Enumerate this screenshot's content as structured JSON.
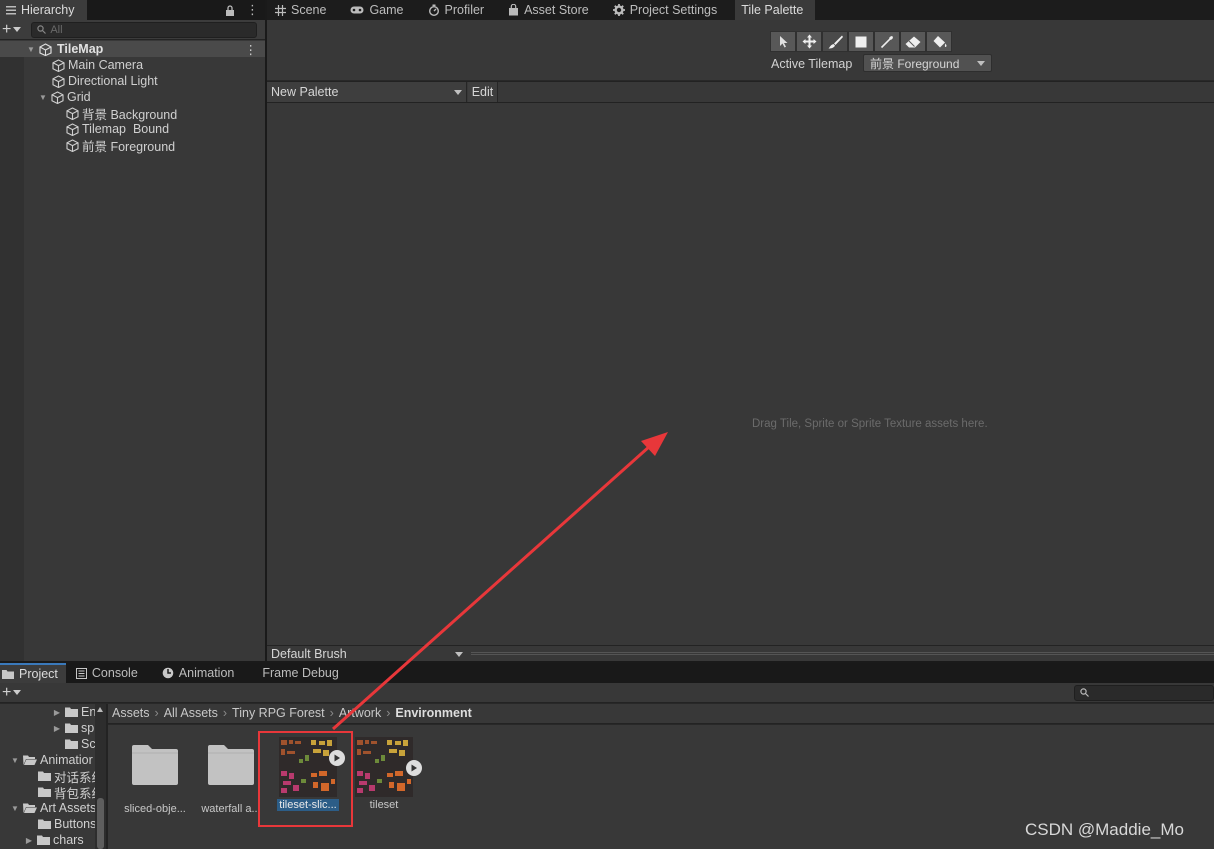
{
  "hierarchy": {
    "tab_label": "Hierarchy",
    "search_placeholder": "All",
    "scene_name": "TileMap",
    "items": [
      {
        "label": "Main Camera"
      },
      {
        "label": "Directional Light"
      },
      {
        "label": "Grid"
      },
      {
        "label": "背景 Background"
      },
      {
        "label": "Tilemap  Bound"
      },
      {
        "label": "前景 Foreground"
      }
    ]
  },
  "top_tabs": [
    {
      "label": "Scene",
      "icon": "grid-icon"
    },
    {
      "label": "Game",
      "icon": "gamepad-icon"
    },
    {
      "label": "Profiler",
      "icon": "stopwatch-icon"
    },
    {
      "label": "Asset Store",
      "icon": "bag-icon"
    },
    {
      "label": "Project Settings",
      "icon": "gear-icon"
    },
    {
      "label": "Tile Palette",
      "icon": ""
    }
  ],
  "palette": {
    "tools": [
      "select",
      "move",
      "paint",
      "box-fill",
      "pick",
      "erase",
      "fill"
    ],
    "active_tilemap_label": "Active Tilemap",
    "active_tilemap_value": "前景 Foreground",
    "palette_dropdown": "New Palette",
    "edit_label": "Edit",
    "drop_hint": "Drag Tile, Sprite or Sprite Texture assets here.",
    "brush_dropdown": "Default Brush"
  },
  "bottom_tabs": [
    {
      "label": "Project",
      "icon": "folder-icon"
    },
    {
      "label": "Console",
      "icon": "console-icon"
    },
    {
      "label": "Animation",
      "icon": "animation-icon"
    },
    {
      "label": "Frame Debug",
      "icon": ""
    }
  ],
  "project": {
    "tree": [
      {
        "label": "En"
      },
      {
        "label": "sp"
      },
      {
        "label": "Scer"
      },
      {
        "label": "Animatior"
      },
      {
        "label": "对话系约"
      },
      {
        "label": "背包系约"
      },
      {
        "label": "Art Assets"
      },
      {
        "label": "Buttons"
      },
      {
        "label": "chars"
      }
    ],
    "breadcrumb": [
      "Assets",
      "All Assets",
      "Tiny RPG Forest",
      "Artwork",
      "Environment"
    ],
    "assets": [
      {
        "label": "sliced-obje...",
        "kind": "folder"
      },
      {
        "label": "waterfall a...",
        "kind": "folder"
      },
      {
        "label": "tileset-slic...",
        "kind": "spritesheet",
        "selected": true
      },
      {
        "label": "tileset",
        "kind": "spritesheet",
        "selected": false
      }
    ]
  },
  "watermark": "CSDN @Maddie_Mo",
  "colors": {
    "annotation_red": "#e8373a",
    "selection_blue": "#2c5d87",
    "panel_bg": "#383838",
    "window_bg": "#282828"
  }
}
